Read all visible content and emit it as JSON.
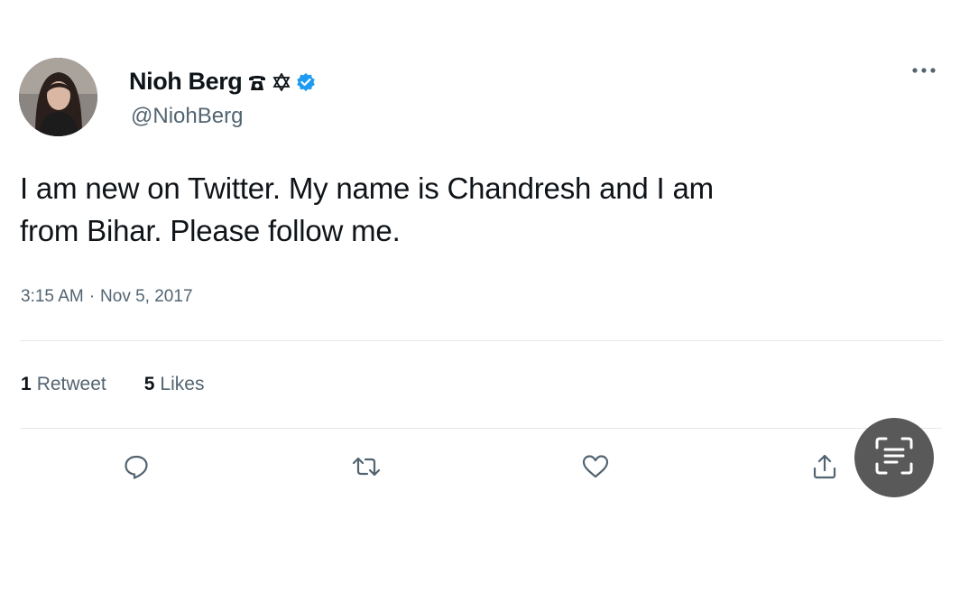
{
  "tweet": {
    "author": {
      "display_name": "Nioh Berg",
      "handle": "@NiohBerg",
      "name_icons": [
        "phone-icon",
        "star-of-david-icon",
        "verified-badge-icon"
      ]
    },
    "text": "I am new on Twitter. My name is Chandresh and I am\nfrom Bihar. Please follow me.",
    "time": "3:15 AM",
    "separator": "·",
    "date": "Nov 5, 2017",
    "stats": {
      "retweets_count": "1",
      "retweets_label": "Retweet",
      "likes_count": "5",
      "likes_label": "Likes"
    },
    "actions": [
      "reply-icon",
      "retweet-icon",
      "like-icon",
      "share-icon"
    ]
  },
  "overlay": {
    "icon": "text-scan-icon"
  },
  "colors": {
    "text_primary": "#0f1419",
    "text_secondary": "#536471",
    "verified_blue": "#1d9bf0",
    "divider": "#e4e8ea",
    "overlay_button": "#595959"
  }
}
